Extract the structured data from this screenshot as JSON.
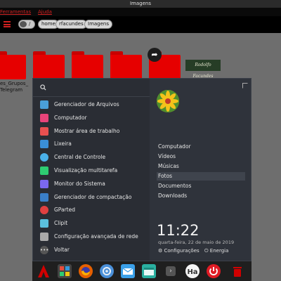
{
  "window": {
    "title": "Imagens"
  },
  "menubar": {
    "items": [
      "Ferramentas",
      "Ajuda"
    ]
  },
  "pathbar": {
    "toggle_text": "/",
    "crumbs": [
      "home",
      "rfacundes",
      "Imagens"
    ]
  },
  "files": {
    "folder_label": "es_Grupos_\nTelegram",
    "logo_text": "Rodolfo Facundes"
  },
  "menu": {
    "search_placeholder": "",
    "apps": [
      {
        "label": "Gerenciador de Arquivos",
        "icon": "file-manager-icon",
        "color": "#4a9fd8"
      },
      {
        "label": "Computador",
        "icon": "computer-icon",
        "color": "#e8447a"
      },
      {
        "label": "Mostrar área de trabalho",
        "icon": "desktop-icon",
        "color": "#e85050"
      },
      {
        "label": "Lixeira",
        "icon": "trash-icon",
        "color": "#3a8fd8"
      },
      {
        "label": "Central de Controle",
        "icon": "control-center-icon",
        "color": "#4ab0e8"
      },
      {
        "label": "Visualização multitarefa",
        "icon": "multitask-icon",
        "color": "#2ecc71"
      },
      {
        "label": "Monitor do Sistema",
        "icon": "system-monitor-icon",
        "color": "#7b68ee"
      },
      {
        "label": "Gerenciador de compactação",
        "icon": "archive-manager-icon",
        "color": "#3a7fc8"
      },
      {
        "label": "GParted",
        "icon": "gparted-icon",
        "color": "#e04040"
      },
      {
        "label": "Clipit",
        "icon": "clipit-icon",
        "color": "#5bc0de"
      },
      {
        "label": "Configuração avançada de rede",
        "icon": "network-config-icon",
        "color": "#aaaaaa"
      }
    ],
    "back_label": "Voltar",
    "places": [
      "Computador",
      "Vídeos",
      "Músicas",
      "Fotos",
      "Documentos",
      "Downloads"
    ],
    "active_place": "Fotos",
    "time": "11:22",
    "date": "quarta-feira, 22 de maio de 2019",
    "settings_label": "Configurações",
    "power_label": "Energia"
  },
  "dock": {
    "apps": [
      {
        "name": "launcher-icon",
        "color": "#d10000"
      },
      {
        "name": "multitask-view-icon",
        "color": "#444444"
      },
      {
        "name": "firefox-icon",
        "color": "#e66000"
      },
      {
        "name": "settings-icon",
        "color": "#4a90d9"
      },
      {
        "name": "mail-icon",
        "color": "#3aa0e8"
      },
      {
        "name": "files-icon",
        "color": "#2ab0a0"
      },
      {
        "name": "more-icon",
        "color": "#555555"
      },
      {
        "name": "font-viewer-icon",
        "color": "#f5f5f5"
      },
      {
        "name": "power-icon",
        "color": "#e01b24"
      },
      {
        "name": "trash-dock-icon",
        "color": "#d10000"
      }
    ]
  }
}
